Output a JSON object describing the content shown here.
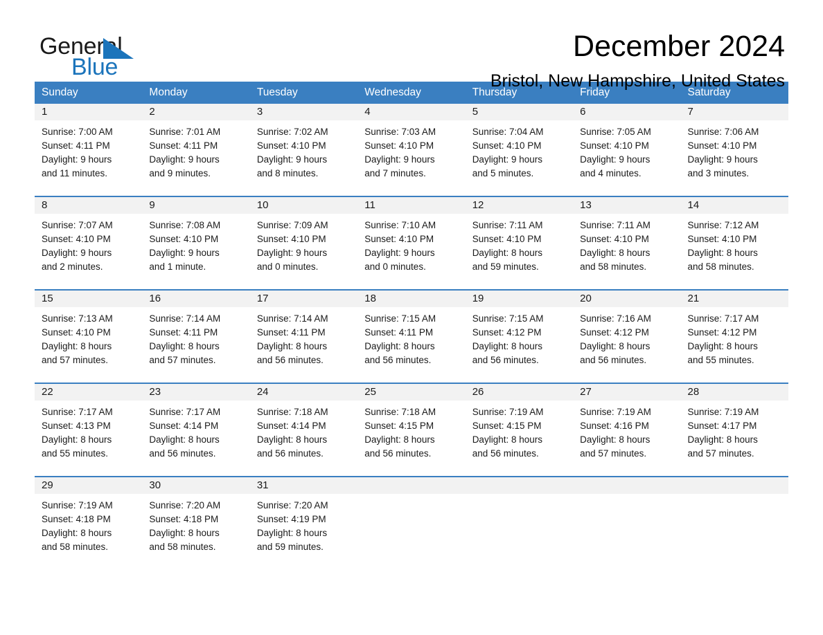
{
  "brand": {
    "name_part1": "General",
    "name_part2": "Blue",
    "accent_color": "#1b74bb",
    "triangle_icon": "triangle-icon"
  },
  "header": {
    "title": "December 2024",
    "subtitle": "Bristol, New Hampshire, United States"
  },
  "calendar": {
    "header_bg": "#3a7fc1",
    "daynum_bg": "#f2f2f2",
    "weekdays": [
      "Sunday",
      "Monday",
      "Tuesday",
      "Wednesday",
      "Thursday",
      "Friday",
      "Saturday"
    ],
    "weeks": [
      [
        {
          "day": "1",
          "sunrise": "Sunrise: 7:00 AM",
          "sunset": "Sunset: 4:11 PM",
          "daylight1": "Daylight: 9 hours",
          "daylight2": "and 11 minutes."
        },
        {
          "day": "2",
          "sunrise": "Sunrise: 7:01 AM",
          "sunset": "Sunset: 4:11 PM",
          "daylight1": "Daylight: 9 hours",
          "daylight2": "and 9 minutes."
        },
        {
          "day": "3",
          "sunrise": "Sunrise: 7:02 AM",
          "sunset": "Sunset: 4:10 PM",
          "daylight1": "Daylight: 9 hours",
          "daylight2": "and 8 minutes."
        },
        {
          "day": "4",
          "sunrise": "Sunrise: 7:03 AM",
          "sunset": "Sunset: 4:10 PM",
          "daylight1": "Daylight: 9 hours",
          "daylight2": "and 7 minutes."
        },
        {
          "day": "5",
          "sunrise": "Sunrise: 7:04 AM",
          "sunset": "Sunset: 4:10 PM",
          "daylight1": "Daylight: 9 hours",
          "daylight2": "and 5 minutes."
        },
        {
          "day": "6",
          "sunrise": "Sunrise: 7:05 AM",
          "sunset": "Sunset: 4:10 PM",
          "daylight1": "Daylight: 9 hours",
          "daylight2": "and 4 minutes."
        },
        {
          "day": "7",
          "sunrise": "Sunrise: 7:06 AM",
          "sunset": "Sunset: 4:10 PM",
          "daylight1": "Daylight: 9 hours",
          "daylight2": "and 3 minutes."
        }
      ],
      [
        {
          "day": "8",
          "sunrise": "Sunrise: 7:07 AM",
          "sunset": "Sunset: 4:10 PM",
          "daylight1": "Daylight: 9 hours",
          "daylight2": "and 2 minutes."
        },
        {
          "day": "9",
          "sunrise": "Sunrise: 7:08 AM",
          "sunset": "Sunset: 4:10 PM",
          "daylight1": "Daylight: 9 hours",
          "daylight2": "and 1 minute."
        },
        {
          "day": "10",
          "sunrise": "Sunrise: 7:09 AM",
          "sunset": "Sunset: 4:10 PM",
          "daylight1": "Daylight: 9 hours",
          "daylight2": "and 0 minutes."
        },
        {
          "day": "11",
          "sunrise": "Sunrise: 7:10 AM",
          "sunset": "Sunset: 4:10 PM",
          "daylight1": "Daylight: 9 hours",
          "daylight2": "and 0 minutes."
        },
        {
          "day": "12",
          "sunrise": "Sunrise: 7:11 AM",
          "sunset": "Sunset: 4:10 PM",
          "daylight1": "Daylight: 8 hours",
          "daylight2": "and 59 minutes."
        },
        {
          "day": "13",
          "sunrise": "Sunrise: 7:11 AM",
          "sunset": "Sunset: 4:10 PM",
          "daylight1": "Daylight: 8 hours",
          "daylight2": "and 58 minutes."
        },
        {
          "day": "14",
          "sunrise": "Sunrise: 7:12 AM",
          "sunset": "Sunset: 4:10 PM",
          "daylight1": "Daylight: 8 hours",
          "daylight2": "and 58 minutes."
        }
      ],
      [
        {
          "day": "15",
          "sunrise": "Sunrise: 7:13 AM",
          "sunset": "Sunset: 4:10 PM",
          "daylight1": "Daylight: 8 hours",
          "daylight2": "and 57 minutes."
        },
        {
          "day": "16",
          "sunrise": "Sunrise: 7:14 AM",
          "sunset": "Sunset: 4:11 PM",
          "daylight1": "Daylight: 8 hours",
          "daylight2": "and 57 minutes."
        },
        {
          "day": "17",
          "sunrise": "Sunrise: 7:14 AM",
          "sunset": "Sunset: 4:11 PM",
          "daylight1": "Daylight: 8 hours",
          "daylight2": "and 56 minutes."
        },
        {
          "day": "18",
          "sunrise": "Sunrise: 7:15 AM",
          "sunset": "Sunset: 4:11 PM",
          "daylight1": "Daylight: 8 hours",
          "daylight2": "and 56 minutes."
        },
        {
          "day": "19",
          "sunrise": "Sunrise: 7:15 AM",
          "sunset": "Sunset: 4:12 PM",
          "daylight1": "Daylight: 8 hours",
          "daylight2": "and 56 minutes."
        },
        {
          "day": "20",
          "sunrise": "Sunrise: 7:16 AM",
          "sunset": "Sunset: 4:12 PM",
          "daylight1": "Daylight: 8 hours",
          "daylight2": "and 56 minutes."
        },
        {
          "day": "21",
          "sunrise": "Sunrise: 7:17 AM",
          "sunset": "Sunset: 4:12 PM",
          "daylight1": "Daylight: 8 hours",
          "daylight2": "and 55 minutes."
        }
      ],
      [
        {
          "day": "22",
          "sunrise": "Sunrise: 7:17 AM",
          "sunset": "Sunset: 4:13 PM",
          "daylight1": "Daylight: 8 hours",
          "daylight2": "and 55 minutes."
        },
        {
          "day": "23",
          "sunrise": "Sunrise: 7:17 AM",
          "sunset": "Sunset: 4:14 PM",
          "daylight1": "Daylight: 8 hours",
          "daylight2": "and 56 minutes."
        },
        {
          "day": "24",
          "sunrise": "Sunrise: 7:18 AM",
          "sunset": "Sunset: 4:14 PM",
          "daylight1": "Daylight: 8 hours",
          "daylight2": "and 56 minutes."
        },
        {
          "day": "25",
          "sunrise": "Sunrise: 7:18 AM",
          "sunset": "Sunset: 4:15 PM",
          "daylight1": "Daylight: 8 hours",
          "daylight2": "and 56 minutes."
        },
        {
          "day": "26",
          "sunrise": "Sunrise: 7:19 AM",
          "sunset": "Sunset: 4:15 PM",
          "daylight1": "Daylight: 8 hours",
          "daylight2": "and 56 minutes."
        },
        {
          "day": "27",
          "sunrise": "Sunrise: 7:19 AM",
          "sunset": "Sunset: 4:16 PM",
          "daylight1": "Daylight: 8 hours",
          "daylight2": "and 57 minutes."
        },
        {
          "day": "28",
          "sunrise": "Sunrise: 7:19 AM",
          "sunset": "Sunset: 4:17 PM",
          "daylight1": "Daylight: 8 hours",
          "daylight2": "and 57 minutes."
        }
      ],
      [
        {
          "day": "29",
          "sunrise": "Sunrise: 7:19 AM",
          "sunset": "Sunset: 4:18 PM",
          "daylight1": "Daylight: 8 hours",
          "daylight2": "and 58 minutes."
        },
        {
          "day": "30",
          "sunrise": "Sunrise: 7:20 AM",
          "sunset": "Sunset: 4:18 PM",
          "daylight1": "Daylight: 8 hours",
          "daylight2": "and 58 minutes."
        },
        {
          "day": "31",
          "sunrise": "Sunrise: 7:20 AM",
          "sunset": "Sunset: 4:19 PM",
          "daylight1": "Daylight: 8 hours",
          "daylight2": "and 59 minutes."
        },
        {
          "day": "",
          "sunrise": "",
          "sunset": "",
          "daylight1": "",
          "daylight2": ""
        },
        {
          "day": "",
          "sunrise": "",
          "sunset": "",
          "daylight1": "",
          "daylight2": ""
        },
        {
          "day": "",
          "sunrise": "",
          "sunset": "",
          "daylight1": "",
          "daylight2": ""
        },
        {
          "day": "",
          "sunrise": "",
          "sunset": "",
          "daylight1": "",
          "daylight2": ""
        }
      ]
    ]
  }
}
